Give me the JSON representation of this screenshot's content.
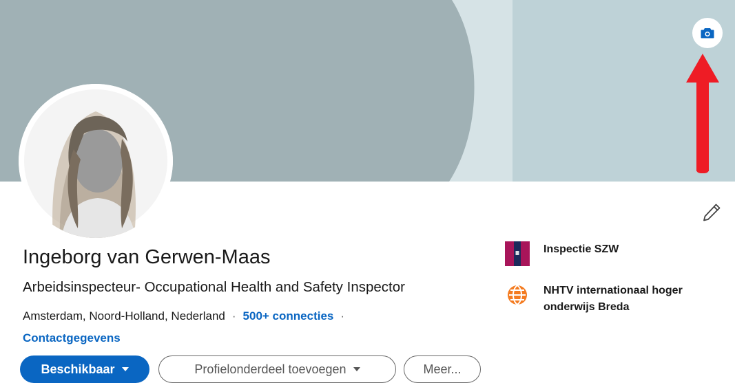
{
  "profile": {
    "name": "Ingeborg van Gerwen-Maas",
    "headline": "Arbeidsinspecteur- Occupational Health and Safety Inspector",
    "location": "Amsterdam, Noord-Holland, Nederland",
    "separator": "·",
    "connections": "500+ connecties",
    "contact_info": "Contactgegevens"
  },
  "actions": {
    "available": "Beschikbaar",
    "add_section": "Profielonderdeel toevoegen",
    "more": "Meer..."
  },
  "organizations": [
    {
      "name": "Inspectie SZW",
      "icon": "inspectie-szw-logo"
    },
    {
      "name": "NHTV internationaal hoger onderwijs Breda",
      "icon": "nhtv-logo"
    }
  ],
  "colors": {
    "accent": "#0a66c2",
    "banner_dark": "#a0b1b5",
    "banner_mid": "#d6e3e6",
    "banner_light": "#bed2d7",
    "arrow": "#ee1c25"
  },
  "icons": {
    "camera": "camera-icon",
    "edit": "pencil-icon",
    "arrow": "red-arrow-annotation"
  }
}
